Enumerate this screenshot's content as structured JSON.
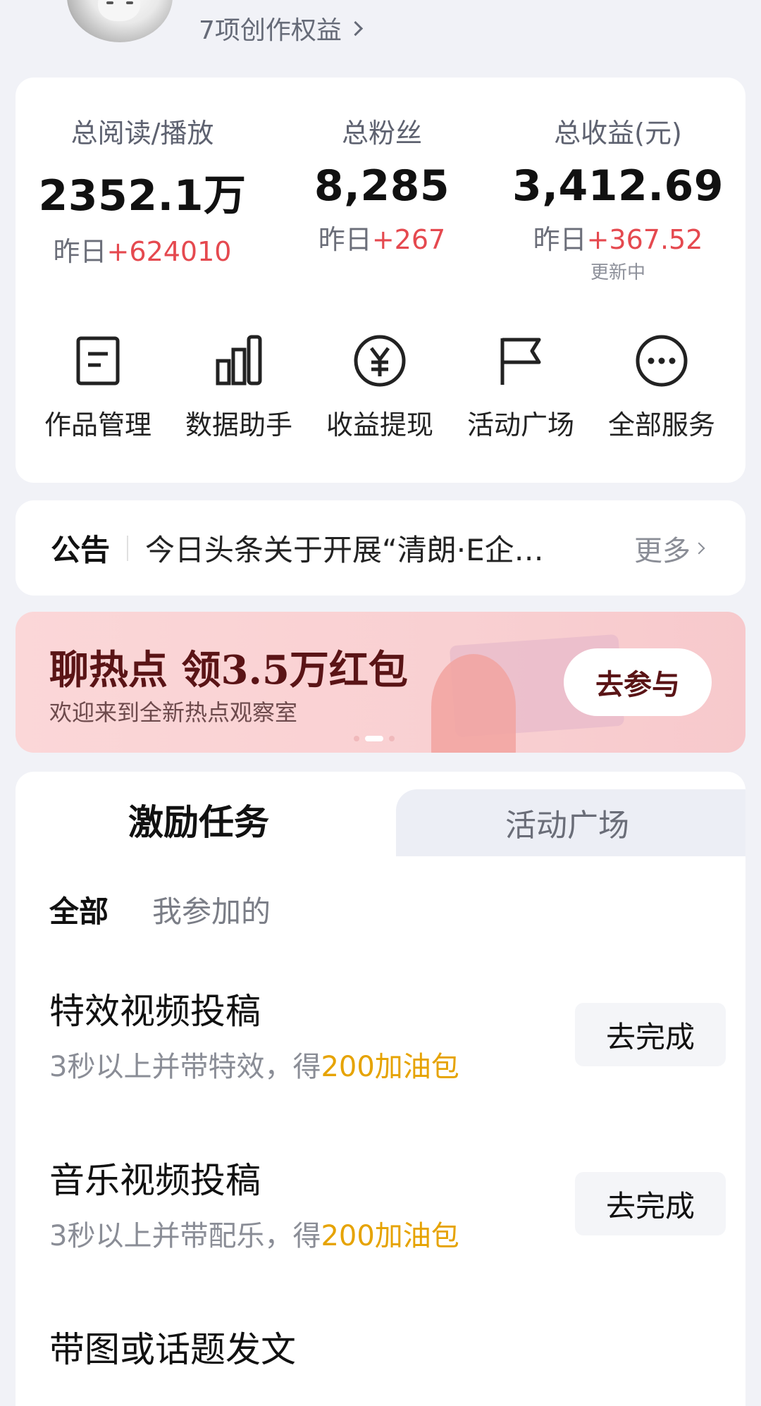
{
  "header": {
    "benefits_label": "7项创作权益"
  },
  "stats": [
    {
      "label": "总阅读/播放",
      "value": "2352.1万",
      "delta_prefix": "昨日",
      "delta": "+624010",
      "note": ""
    },
    {
      "label": "总粉丝",
      "value": "8,285",
      "delta_prefix": "昨日",
      "delta": "+267",
      "note": ""
    },
    {
      "label": "总收益(元)",
      "value": "3,412.69",
      "delta_prefix": "昨日",
      "delta": "+367.52",
      "note": "更新中"
    }
  ],
  "services": [
    {
      "label": "作品管理",
      "icon": "document-icon"
    },
    {
      "label": "数据助手",
      "icon": "bar-chart-icon"
    },
    {
      "label": "收益提现",
      "icon": "yen-icon"
    },
    {
      "label": "活动广场",
      "icon": "flag-icon"
    },
    {
      "label": "全部服务",
      "icon": "more-icon"
    }
  ],
  "notice": {
    "tag": "公告",
    "text": "今日头条关于开展“清朗·E企…",
    "more": "更多"
  },
  "banner": {
    "title": "聊热点 领3.5万红包",
    "subtitle": "欢迎来到全新热点观察室",
    "button": "去参与"
  },
  "tabs": {
    "active": "激励任务",
    "inactive": "活动广场"
  },
  "filters": {
    "all": "全部",
    "joined": "我参加的"
  },
  "tasks": [
    {
      "title": "特效视频投稿",
      "desc": "3秒以上并带特效，得",
      "reward": "200加油包",
      "button": "去完成"
    },
    {
      "title": "音乐视频投稿",
      "desc": "3秒以上并带配乐，得",
      "reward": "200加油包",
      "button": "去完成"
    },
    {
      "title": "带图或话题发文",
      "desc": "",
      "reward": "",
      "button": ""
    }
  ],
  "colors": {
    "accent_red": "#e5494f",
    "reward_orange": "#e6a300",
    "banner_text": "#5a1416"
  }
}
